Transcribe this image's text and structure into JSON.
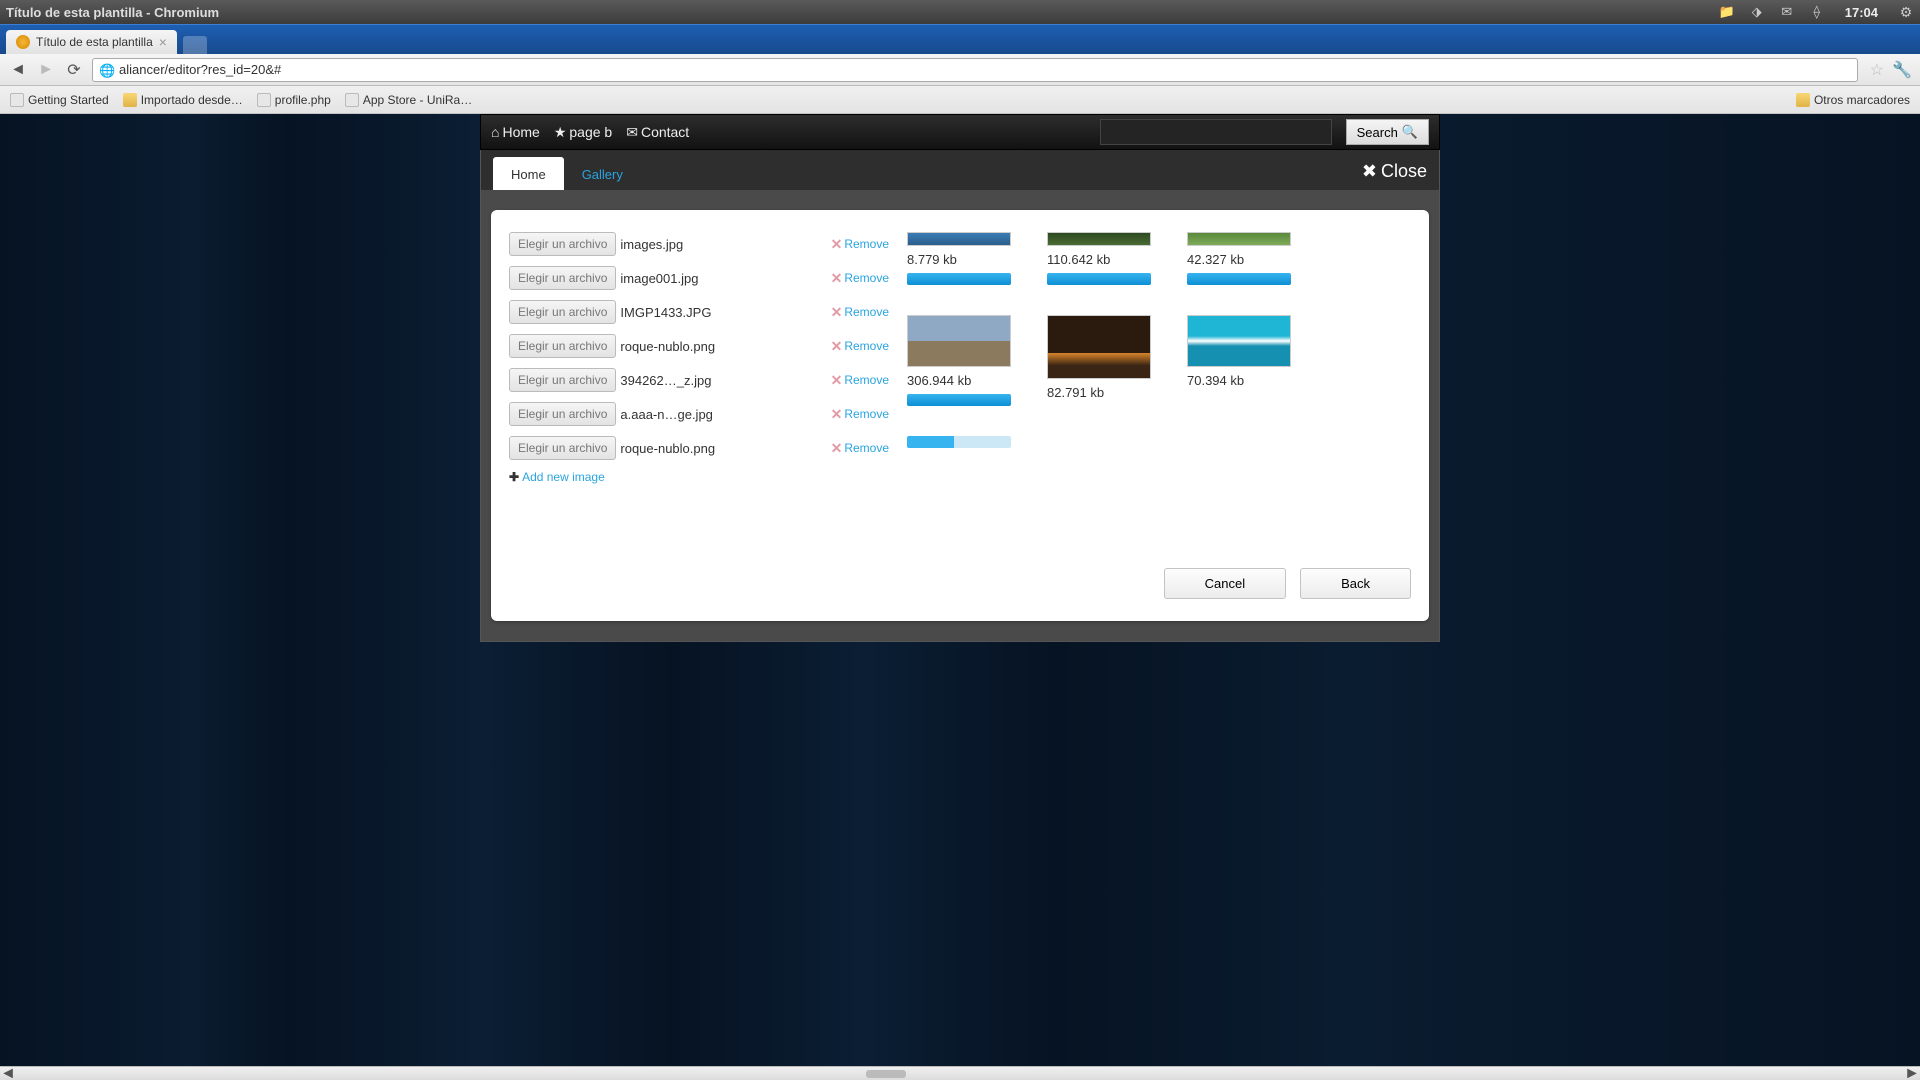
{
  "os": {
    "title": "Título de esta plantilla - Chromium",
    "time": "17:04"
  },
  "browser": {
    "tab_title": "Título de esta plantilla",
    "url": "aliancer/editor?res_id=20&#",
    "bookmarks": {
      "b0": "Getting Started",
      "b1": "Importado desde…",
      "b2": "profile.php",
      "b3": "App Store - UniRa…",
      "other": "Otros marcadores"
    }
  },
  "topnav": {
    "home": "Home",
    "pageb": "page b",
    "contact": "Contact",
    "search_label": "Search"
  },
  "modal": {
    "tab_home": "Home",
    "tab_gallery": "Gallery",
    "close": "Close",
    "choose_label": "Elegir un archivo",
    "remove_label": "Remove",
    "add_new": "Add new image",
    "files": {
      "f0": "images.jpg",
      "f1": "image001.jpg",
      "f2": "IMGP1433.JPG",
      "f3": "roque-nublo.png",
      "f4": "394262…_z.jpg",
      "f5": "a.aaa-n…ge.jpg",
      "f6": "roque-nublo.png"
    },
    "sizes": {
      "s0": "8.779 kb",
      "s1": "110.642 kb",
      "s2": "42.327 kb",
      "s3": "306.944 kb",
      "s4": "82.791 kb",
      "s5": "70.394 kb"
    },
    "cancel": "Cancel",
    "back": "Back"
  }
}
